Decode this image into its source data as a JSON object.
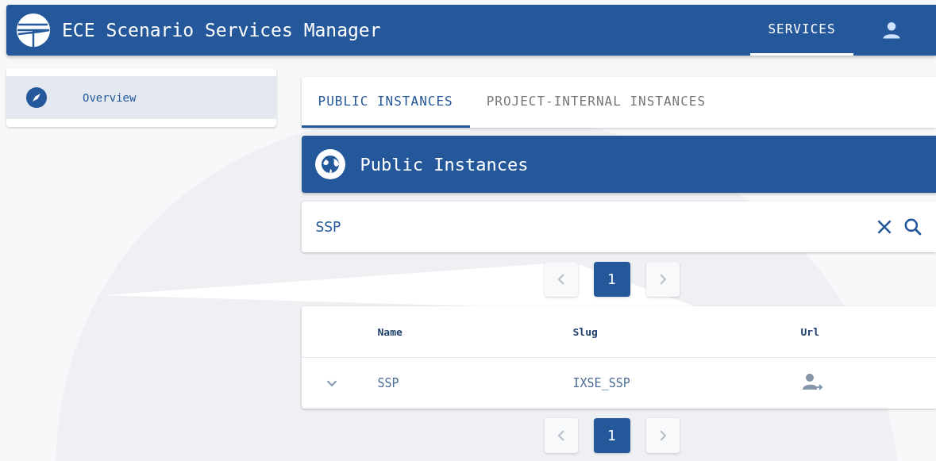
{
  "app_bar": {
    "title": "ECE Scenario Services Manager",
    "nav": [
      {
        "label": "SERVICES",
        "selected": true
      }
    ]
  },
  "sidebar": {
    "items": [
      {
        "label": "Overview",
        "selected": true
      }
    ]
  },
  "tabs": [
    {
      "label": "PUBLIC INSTANCES",
      "selected": true
    },
    {
      "label": "PROJECT-INTERNAL INSTANCES",
      "selected": false
    }
  ],
  "panel": {
    "title": "Public Instances"
  },
  "search": {
    "value": "SSP"
  },
  "pager_top": {
    "pages": [
      {
        "label": "1",
        "selected": true
      }
    ]
  },
  "table": {
    "columns": [
      "Name",
      "Slug",
      "Url"
    ],
    "rows": [
      {
        "expanded": false,
        "name": "SSP",
        "slug": "IXSE_SSP"
      }
    ]
  },
  "pager_bottom": {
    "pages": [
      {
        "label": "1",
        "selected": true
      }
    ]
  }
}
